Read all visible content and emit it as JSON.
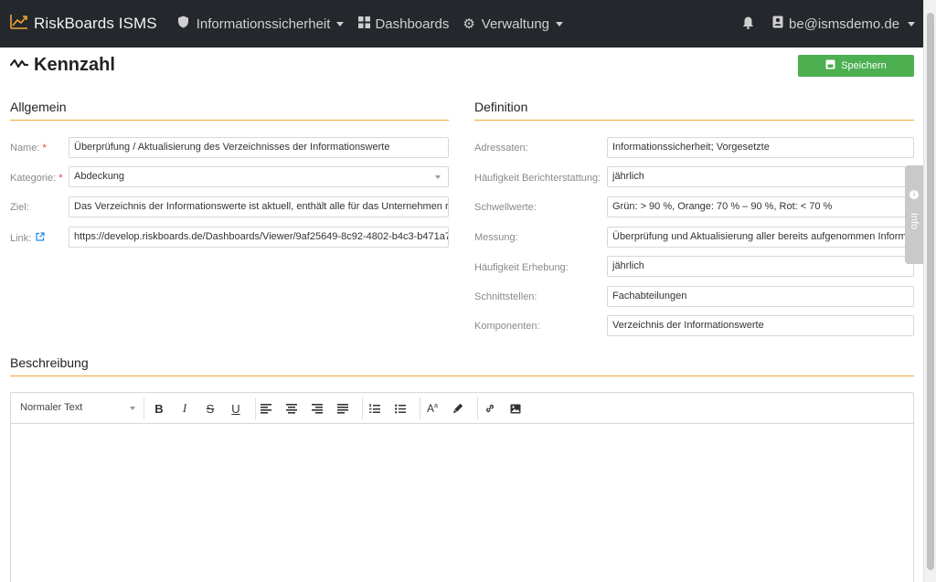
{
  "navbar": {
    "brand": "RiskBoards ISMS",
    "items": [
      {
        "label": "Informationssicherheit",
        "icon": "shield-icon",
        "dropdown": true
      },
      {
        "label": "Dashboards",
        "icon": "grid-icon",
        "dropdown": false
      },
      {
        "label": "Verwaltung",
        "icon": "gear-icon",
        "dropdown": true
      }
    ],
    "user": "be@ismsdemo.de"
  },
  "page": {
    "title": "Kennzahl",
    "save_label": "Speichern"
  },
  "general": {
    "title": "Allgemein",
    "fields": {
      "name_label": "Name:",
      "name_value": "Überprüfung / Aktualisierung des Verzeichnisses der Informationswerte",
      "category_label": "Kategorie:",
      "category_value": "Abdeckung",
      "goal_label": "Ziel:",
      "goal_value": "Das Verzeichnis der Informationswerte ist aktuell, enthält alle für das Unternehmen re",
      "link_label": "Link:",
      "link_value": "https://develop.riskboards.de/Dashboards/Viewer/9af25649-8c92-4802-b4c3-b471a7"
    },
    "required_mark": "*"
  },
  "definition": {
    "title": "Definition",
    "fields": [
      {
        "label": "Adressaten:",
        "value": "Informationssicherheit; Vorgesetzte"
      },
      {
        "label": "Häufigkeit Berichterstattung:",
        "value": "jährlich"
      },
      {
        "label": "Schwellwerte:",
        "value": "Grün: > 90 %, Orange: 70 % – 90 %, Rot: < 70 %"
      },
      {
        "label": "Messung:",
        "value": "Überprüfung und Aktualisierung aller bereits aufgenommen Inform"
      },
      {
        "label": "Häufigkeit Erhebung:",
        "value": "jährlich"
      },
      {
        "label": "Schnittstellen:",
        "value": "Fachabteilungen"
      },
      {
        "label": "Komponenten:",
        "value": "Verzeichnis der Informationswerte"
      }
    ]
  },
  "info_tab": {
    "label": "Info"
  },
  "description": {
    "title": "Beschreibung",
    "format_select": "Normaler Text"
  },
  "colors": {
    "navbar_bg": "#24272b",
    "accent": "#f0a830",
    "save_button": "#4caf50",
    "required": "#e53935",
    "link_icon": "#1e88e5"
  }
}
